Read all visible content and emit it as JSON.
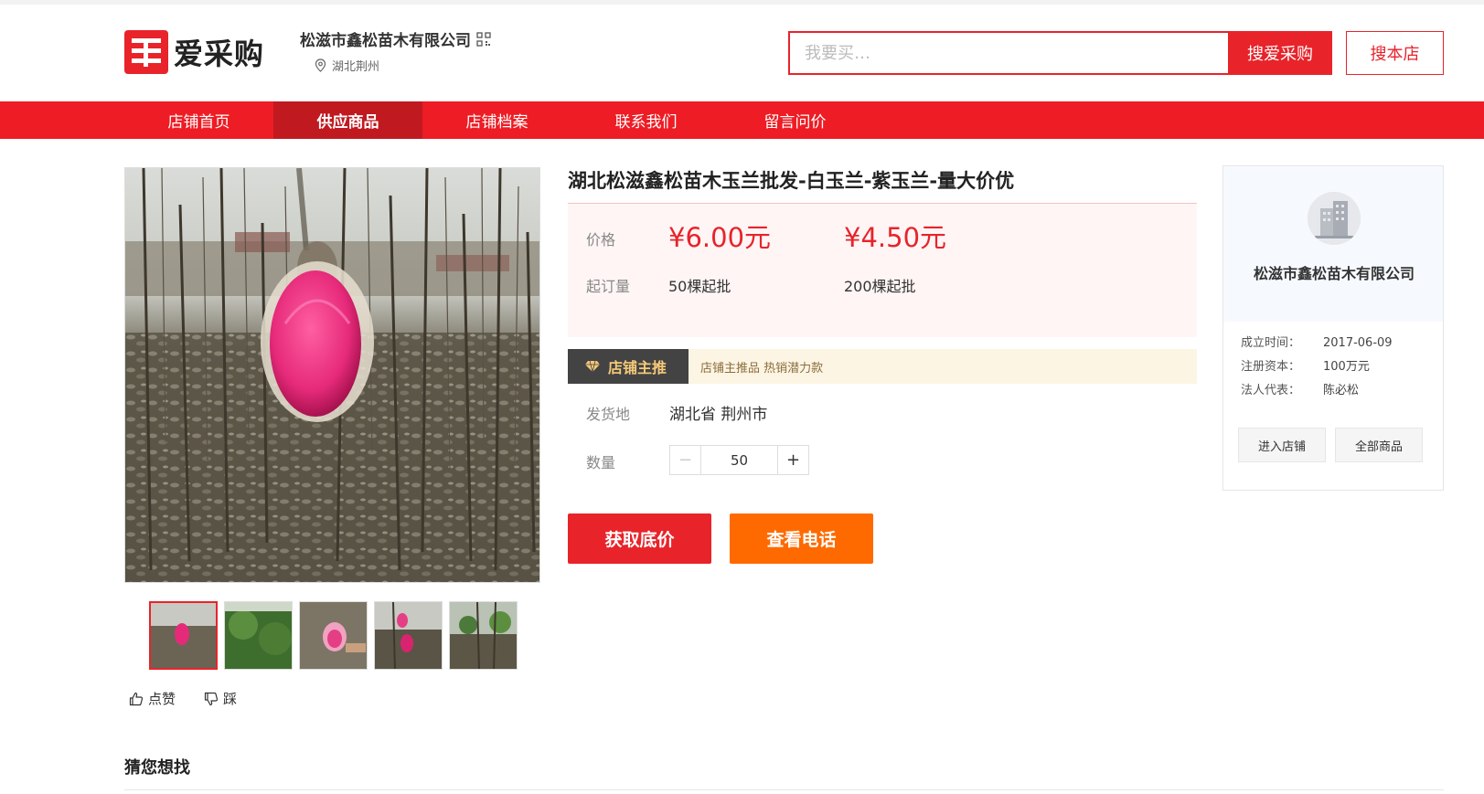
{
  "brand": {
    "logo_text": "爱采购",
    "accent": "#e8232a"
  },
  "shop": {
    "name": "松滋市鑫松苗木有限公司",
    "location": "湖北荆州"
  },
  "search": {
    "placeholder": "我要买…",
    "search_label": "搜爱采购",
    "shop_search_label": "搜本店"
  },
  "nav": {
    "items": [
      {
        "label": "店铺首页"
      },
      {
        "label": "供应商品"
      },
      {
        "label": "店铺档案"
      },
      {
        "label": "联系我们"
      },
      {
        "label": "留言问价"
      }
    ],
    "active_index": 1,
    "color": "#ee1c24"
  },
  "product": {
    "title": "湖北松滋鑫松苗木玉兰批发-白玉兰-紫玉兰-量大价优",
    "price_label": "价格",
    "prices": [
      "¥6.00元",
      "¥4.50元"
    ],
    "moq_label": "起订量",
    "moqs": [
      "50棵起批",
      "200棵起批"
    ],
    "promo_tag": "店铺主推",
    "promo_text": "店铺主推品 热销潜力款",
    "ship_label": "发货地",
    "ship_value": "湖北省 荆州市",
    "qty_label": "数量",
    "qty_value": "50",
    "get_price_label": "获取底价",
    "view_phone_label": "查看电话",
    "like_label": "点赞",
    "dislike_label": "踩"
  },
  "company": {
    "name": "松滋市鑫松苗木有限公司",
    "info": [
      {
        "k": "成立时间：",
        "v": "2017-06-09"
      },
      {
        "k": "注册资本：",
        "v": "100万元"
      },
      {
        "k": "法人代表：",
        "v": "陈必松"
      }
    ],
    "enter_shop_label": "进入店铺",
    "all_products_label": "全部商品"
  },
  "guess": {
    "title": "猜您想找"
  }
}
